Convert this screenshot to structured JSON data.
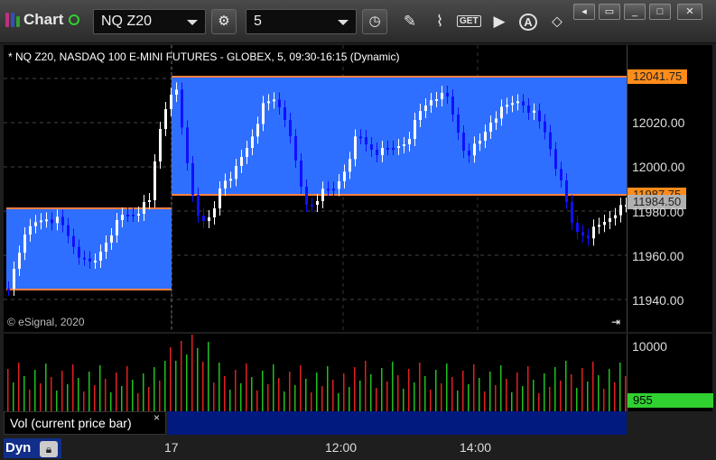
{
  "toolbar": {
    "app_title": "Chart",
    "symbol": "NQ Z20",
    "interval": "5",
    "icons": [
      "refresh-gear-icon",
      "clock-icon",
      "pencil-icon",
      "study-icon",
      "get-icon",
      "play-icon",
      "alert-icon",
      "pin-icon"
    ],
    "get_label": "GET",
    "alert_label": "A"
  },
  "window": {
    "icons": [
      "back-icon",
      "restore-icon",
      "maximize-icon",
      "close-icon"
    ]
  },
  "chart": {
    "title": "* NQ Z20, NASDAQ 100 E-MINI FUTURES - GLOBEX, 5, 09:30-16:15 (Dynamic)",
    "copyright": "© eSignal, 2020",
    "colors": {
      "up": "#ffffff",
      "down": "#1010ff",
      "band": "#2f6fff",
      "band_line": "#ff8040"
    },
    "price_labels": [
      "12020.00",
      "12000.00",
      "11980.00",
      "11960.00",
      "11940.00"
    ],
    "tag_high": "12041.75",
    "tag_low": "11987.75",
    "tag_last": "11984.50"
  },
  "volume": {
    "label": "Vol (current price bar)",
    "close": "×",
    "axis_top": "10000",
    "last": "955",
    "colors": {
      "up": "#20c020",
      "down": "#e02020",
      "last_tag": "#30d030"
    }
  },
  "time_axis": {
    "labels": [
      "17",
      "12:00",
      "14:00"
    ],
    "dyn_label": "Dyn"
  }
}
